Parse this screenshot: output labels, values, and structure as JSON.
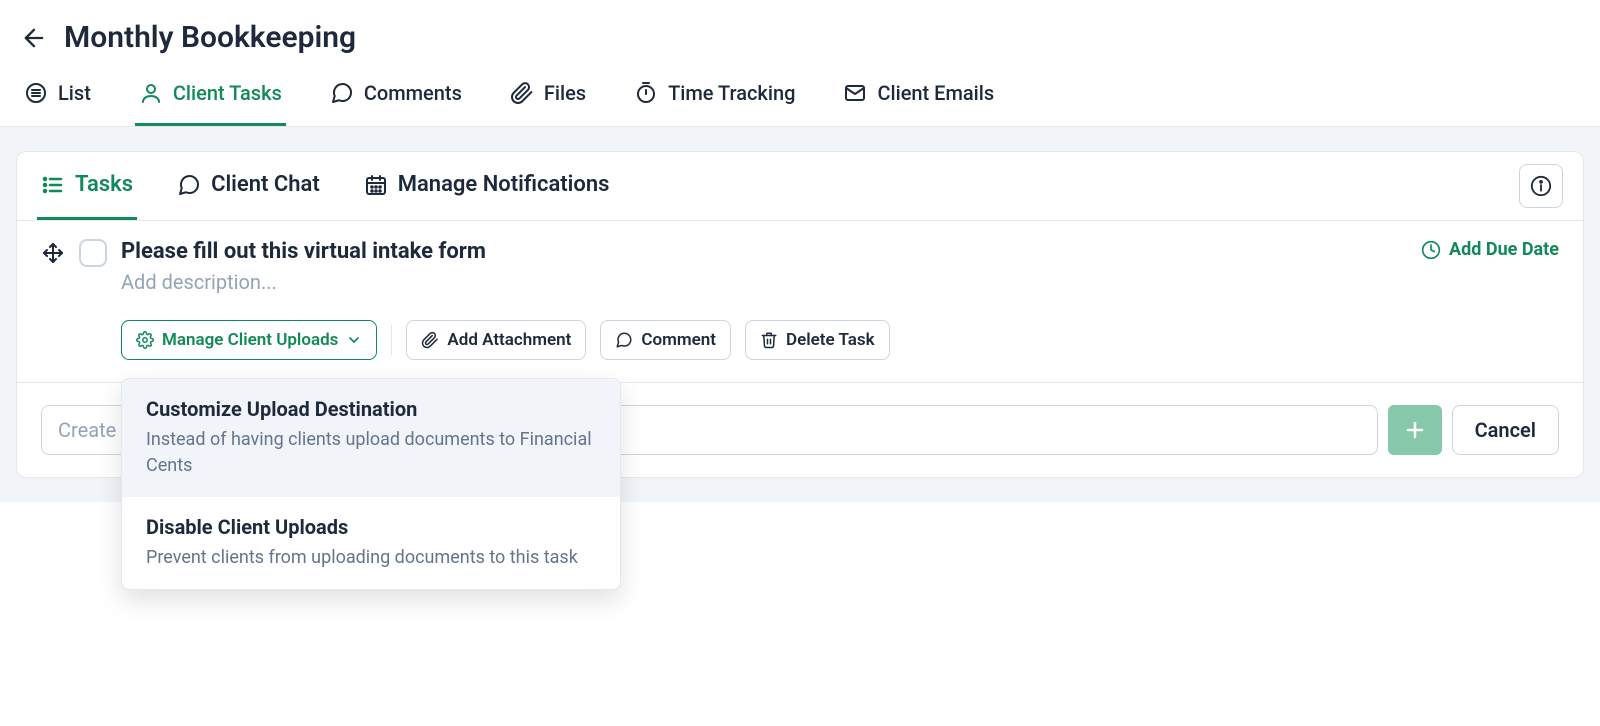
{
  "header": {
    "title": "Monthly Bookkeeping"
  },
  "topTabs": {
    "list": "List",
    "clientTasks": "Client Tasks",
    "comments": "Comments",
    "files": "Files",
    "timeTracking": "Time Tracking",
    "clientEmails": "Client Emails"
  },
  "subTabs": {
    "tasks": "Tasks",
    "clientChat": "Client Chat",
    "manageNotifications": "Manage Notifications"
  },
  "task": {
    "title": "Please fill out this virtual intake form",
    "descPlaceholder": "Add description...",
    "dueDate": "Add Due Date"
  },
  "buttons": {
    "manageUploads": "Manage Client Uploads",
    "addAttachment": "Add Attachment",
    "comment": "Comment",
    "deleteTask": "Delete Task"
  },
  "dropdown": {
    "customizeTitle": "Customize Upload Destination",
    "customizeSub": "Instead of having clients upload documents to Financial Cents",
    "disableTitle": "Disable Client Uploads",
    "disableSub": "Prevent clients from uploading documents to this task"
  },
  "create": {
    "placeholder": "Create a",
    "cancel": "Cancel"
  }
}
